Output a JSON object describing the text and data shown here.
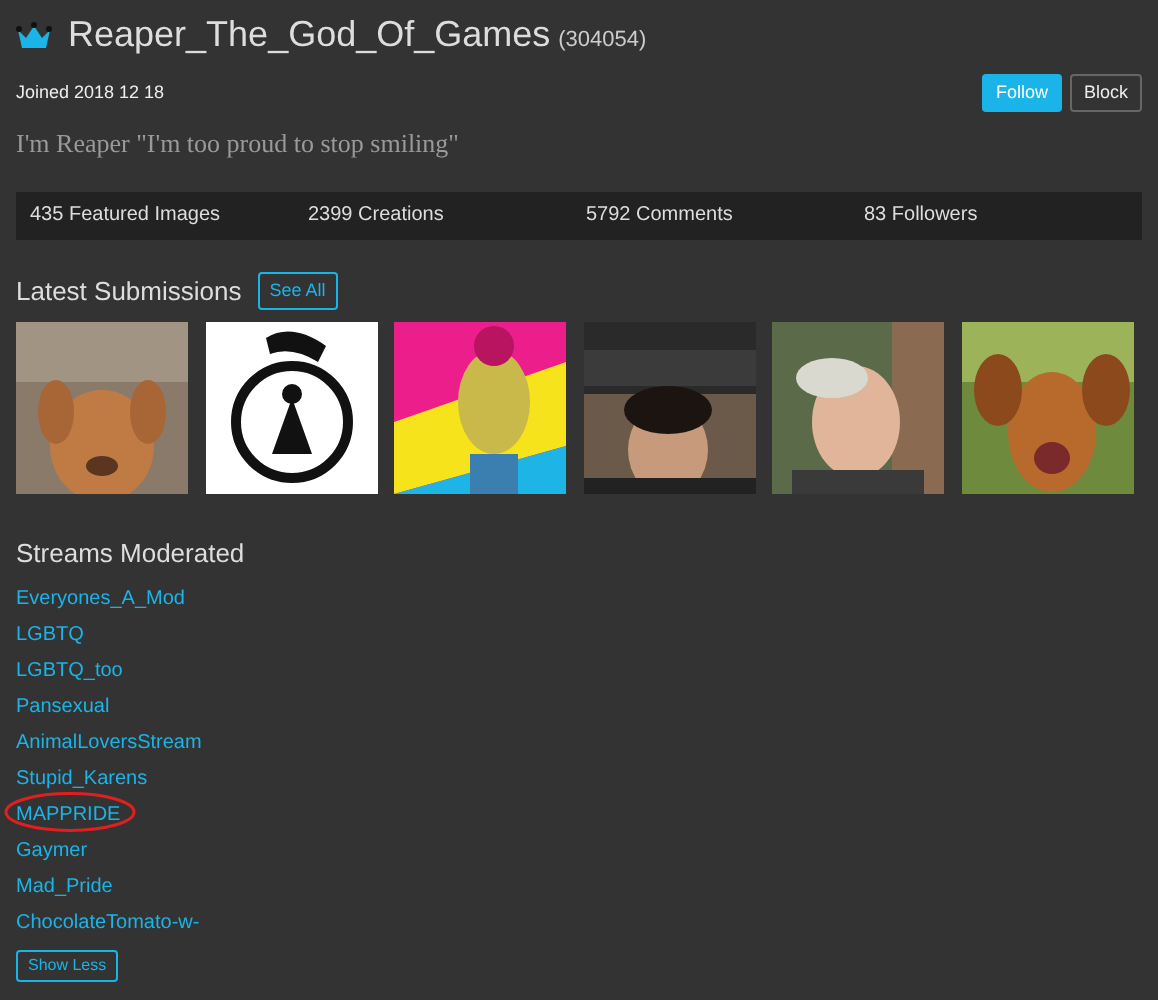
{
  "profile": {
    "username": "Reaper_The_God_Of_Games",
    "points": "(304054)",
    "joined": "Joined 2018 12 18",
    "bio": "I'm Reaper \"I'm too proud to stop smiling\""
  },
  "actions": [
    {
      "label": "Follow",
      "kind": "primary"
    },
    {
      "label": "Block",
      "kind": "outline"
    }
  ],
  "stats": [
    "435 Featured Images",
    "2399 Creations",
    "5792 Comments",
    "83 Followers"
  ],
  "submissions": {
    "title": "Latest Submissions",
    "button": "See All"
  },
  "streams": {
    "title": "Streams Moderated",
    "items": [
      {
        "name": "Everyones_A_Mod",
        "circled": false
      },
      {
        "name": "LGBTQ",
        "circled": false
      },
      {
        "name": "LGBTQ_too",
        "circled": false
      },
      {
        "name": "Pansexual",
        "circled": false
      },
      {
        "name": "AnimalLoversStream",
        "circled": false
      },
      {
        "name": "Stupid_Karens",
        "circled": false
      },
      {
        "name": "MAPPRIDE",
        "circled": true
      },
      {
        "name": "Gaymer",
        "circled": false
      },
      {
        "name": "Mad_Pride",
        "circled": false
      },
      {
        "name": "ChocolateTomato-w-",
        "circled": false
      }
    ],
    "button": "Show Less"
  }
}
